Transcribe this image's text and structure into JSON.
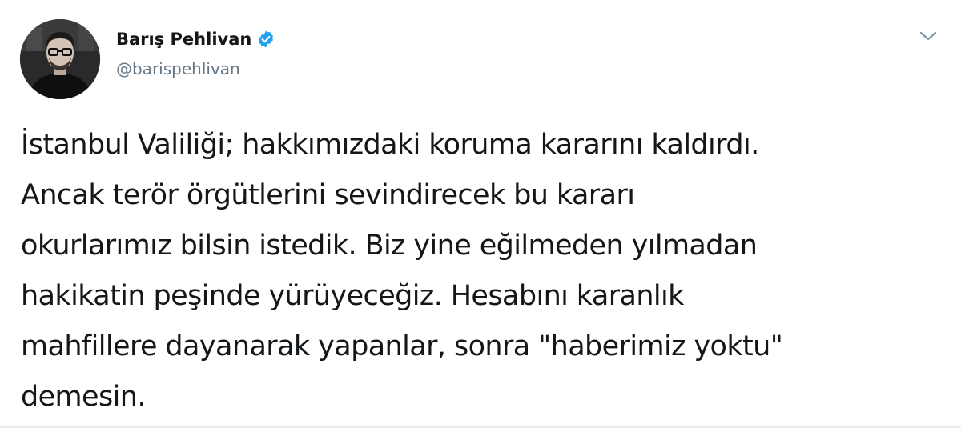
{
  "tweet": {
    "author": {
      "display_name": "Barış Pehlivan",
      "handle": "@barispehlivan",
      "verified": true
    },
    "text_lines": [
      "İstanbul Valiliği; hakkımızdaki koruma kararını kaldırdı.",
      "Ancak terör örgütlerini sevindirecek bu kararı",
      "okurlarımız bilsin istedik. Biz yine eğilmeden yılmadan",
      "hakikatin peşinde yürüyeceğiz. Hesabını karanlık",
      "mahfillere dayanarak yapanlar, sonra \"haberimiz yoktu\"",
      "demesin."
    ]
  },
  "icons": {
    "verified": "verified-badge-icon",
    "menu": "chevron-down-icon"
  },
  "colors": {
    "text": "#14171a",
    "secondary": "#657786",
    "verified_blue": "#1da1f2",
    "caret": "#8899a6"
  }
}
